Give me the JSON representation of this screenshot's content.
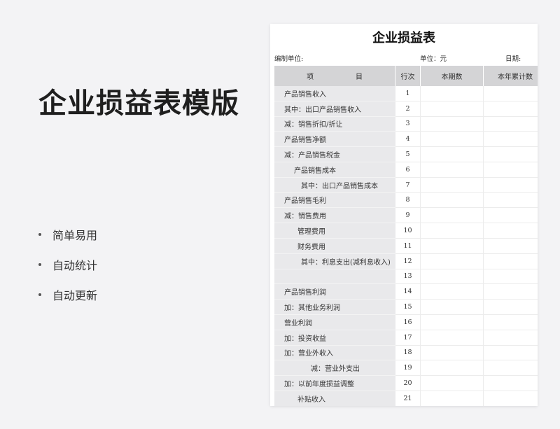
{
  "hero": {
    "title": "企业损益表模版",
    "features": [
      "简单易用",
      "自动统计",
      "自动更新"
    ]
  },
  "sheet": {
    "title": "企业损益表",
    "meta": {
      "org": "编制单位:",
      "unit": "单位：元",
      "date": "日期:"
    },
    "headers": {
      "item": [
        "项",
        "目"
      ],
      "line": "行次",
      "current": "本期数",
      "ytd": "本年累计数"
    },
    "rows": [
      {
        "label": "产品销售收入",
        "line": "1",
        "indent": 0
      },
      {
        "label": "其中：出口产品销售收入",
        "line": "2",
        "indent": 0
      },
      {
        "label": "减：销售折扣/折让",
        "line": "3",
        "indent": 0
      },
      {
        "label": "产品销售净额",
        "line": "4",
        "indent": 0
      },
      {
        "label": "减：产品销售税金",
        "line": "5",
        "indent": 0
      },
      {
        "label": "产品销售成本",
        "line": "6",
        "indent": 3
      },
      {
        "label": "其中：出口产品销售成本",
        "line": "7",
        "indent": 4
      },
      {
        "label": "产品销售毛利",
        "line": "8",
        "indent": 0
      },
      {
        "label": "减：销售费用",
        "line": "9",
        "indent": 0
      },
      {
        "label": "管理费用",
        "line": "10",
        "indent": 1
      },
      {
        "label": "财务费用",
        "line": "11",
        "indent": 1
      },
      {
        "label": "其中：利息支出(减利息收入)",
        "line": "12",
        "indent": 4
      },
      {
        "label": "",
        "line": "13",
        "indent": 0
      },
      {
        "label": "产品销售利润",
        "line": "14",
        "indent": 0
      },
      {
        "label": "加：其他业务利润",
        "line": "15",
        "indent": 0
      },
      {
        "label": "营业利润",
        "line": "16",
        "indent": 0
      },
      {
        "label": "加：投资收益",
        "line": "17",
        "indent": 0
      },
      {
        "label": "加：营业外收入",
        "line": "18",
        "indent": 0
      },
      {
        "label": "减：营业外支出",
        "line": "19",
        "indent": 5
      },
      {
        "label": "加：以前年度损益调整",
        "line": "20",
        "indent": 0
      },
      {
        "label": "补贴收入",
        "line": "21",
        "indent": 2
      }
    ]
  }
}
